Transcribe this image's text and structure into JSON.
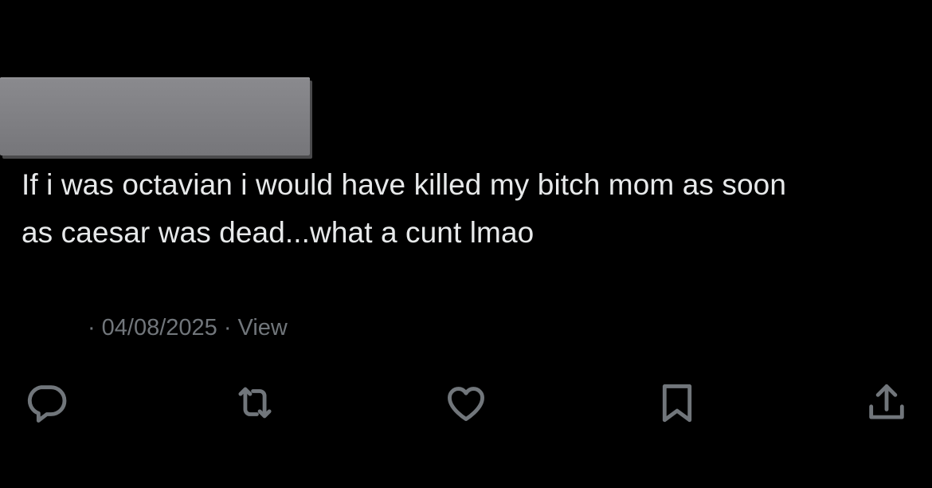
{
  "tweet": {
    "text": "If i was octavian i would have killed my bitch mom as soon\nas caesar was dead...what a cunt lmao",
    "date": "04/08/2025",
    "separator": "·",
    "view_label": "View"
  },
  "actions": {
    "reply_icon": "speech-bubble",
    "retweet_icon": "repost-arrows",
    "like_icon": "heart",
    "bookmark_icon": "bookmark",
    "share_icon": "upload-arrow"
  },
  "colors": {
    "background": "#000000",
    "text": "#e7e9ea",
    "secondary": "#71767b",
    "redaction": "#808084"
  }
}
